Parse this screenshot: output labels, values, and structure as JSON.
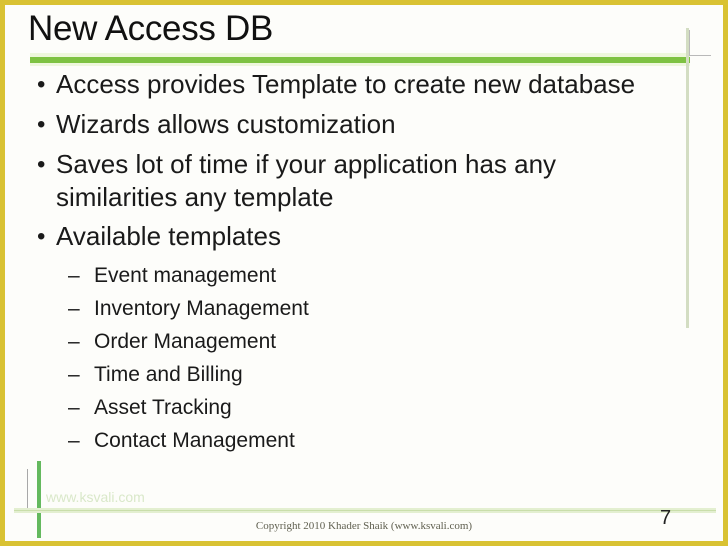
{
  "slide": {
    "title": "New Access DB",
    "page_number": "7",
    "copyright": "Copyright 2010 Khader Shaik (www.ksvali.com)",
    "watermark": "www.ksvali.com",
    "bullet_marker": "•",
    "sub_bullet_marker": "–",
    "colors": {
      "frame_gold": "#d9c233",
      "rule_green": "#7ec242",
      "rule_green_halo": "#eef7dc",
      "accent_green_line": "#64b95e",
      "right_line_green": "#d3ddc2",
      "footer_rule": "#e3efd0",
      "background": "#fdfdfa",
      "text": "#1a1a1a"
    },
    "bullets": [
      {
        "text": "Access provides Template to create new database"
      },
      {
        "text": "Wizards allows customization"
      },
      {
        "text": "Saves lot of time if your application has any similarities any template"
      },
      {
        "text": "Available templates",
        "sub_items": [
          "Event management",
          "Inventory Management",
          "Order Management",
          "Time and Billing",
          "Asset Tracking",
          "Contact Management"
        ]
      }
    ]
  }
}
